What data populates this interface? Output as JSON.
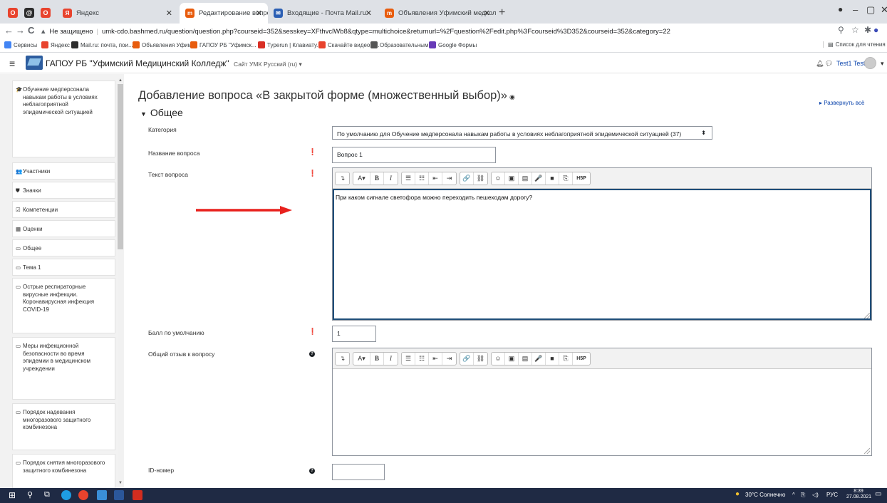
{
  "browser": {
    "pinned_tabs": [
      {
        "icon": "opera-icon",
        "color": "#e8432d",
        "letter": "O"
      },
      {
        "icon": "mailru-icon",
        "color": "#2d2d2d",
        "letter": "@"
      },
      {
        "icon": "opera-icon",
        "color": "#e8432d",
        "letter": "O"
      }
    ],
    "tabs": [
      {
        "label": "Яндекс",
        "active": false,
        "icon_color": "#e8432d"
      },
      {
        "label": "Редактирование вопроса «В за»",
        "active": true,
        "icon_color": "#e85c0d"
      },
      {
        "label": "Входящие - Почта Mail.ru",
        "active": false,
        "icon_color": "#2b5fb4"
      },
      {
        "label": "Объявления Уфимский медкол",
        "active": false,
        "icon_color": "#e85c0d"
      }
    ],
    "new_tab": "+",
    "security_label": "Не защищено",
    "url": "umk-cdo.bashmed.ru/question/question.php?courseid=352&sesskey=XFthvclWb8&qtype=multichoice&returnurl=%2Fquestion%2Fedit.php%3Fcourseid%3D352&courseid=352&category=22",
    "bookmarks": [
      {
        "label": "Сервисы",
        "color": "#4285f4"
      },
      {
        "label": "Яндекс",
        "color": "#e8432d"
      },
      {
        "label": "Mail.ru: почта, пои...",
        "color": "#2d2d2d"
      },
      {
        "label": "Объявления Уфим...",
        "color": "#e85c0d"
      },
      {
        "label": "ГАПОУ РБ \"Уфимск...",
        "color": "#e85c0d"
      },
      {
        "label": "Typerun | Клавиату...",
        "color": "#d93025"
      },
      {
        "label": "Скачайте видео и...",
        "color": "#e8432d"
      },
      {
        "label": "Образовательным...",
        "color": "#555555"
      },
      {
        "label": "Google Формы",
        "color": "#673ab7"
      }
    ],
    "reading_list": "Список для чтения"
  },
  "navbar": {
    "site_name": "ГАПОУ РБ \"Уфимский Медицинский Колледж\"",
    "site_link": "Сайт УМК",
    "language": "Русский (ru) ▾",
    "user": "Test1 Test"
  },
  "drawer": {
    "items": [
      {
        "icon": "graduation-cap-icon",
        "glyph": "🎓",
        "label": "Обучение медперсонала навыкам работы в условиях неблагоприятной эпидемической ситуацией"
      },
      {
        "icon": "users-icon",
        "glyph": "👥",
        "label": "Участники"
      },
      {
        "icon": "shield-icon",
        "glyph": "⛊",
        "label": "Значки"
      },
      {
        "icon": "check-square-icon",
        "glyph": "☑",
        "label": "Компетенции"
      },
      {
        "icon": "table-icon",
        "glyph": "▦",
        "label": "Оценки"
      },
      {
        "icon": "folder-icon",
        "glyph": "▭",
        "label": "Общее"
      },
      {
        "icon": "folder-icon",
        "glyph": "▭",
        "label": "Тема 1"
      },
      {
        "icon": "folder-icon",
        "glyph": "▭",
        "label": "Острые респираторные вирусные инфекции. Коронавирусная инфекция COVID-19"
      },
      {
        "icon": "folder-icon",
        "glyph": "▭",
        "label": "Меры инфекционной безопасности во время эпидемии в медицинском учреждении"
      },
      {
        "icon": "folder-icon",
        "glyph": "▭",
        "label": "Порядок надевания многоразового защитного комбинезона"
      },
      {
        "icon": "folder-icon",
        "glyph": "▭",
        "label": "Порядок снятия многоразового защитного комбинезона"
      }
    ]
  },
  "main": {
    "title": "Добавление вопроса «В закрытой форме (множественный выбор)»",
    "expand_all": "▸ Развернуть всё",
    "section": "Общее",
    "fields": {
      "category_label": "Категория",
      "category_value": "По умолчанию для Обучение медперсонала навыкам работы в условиях неблагоприятной эпидемической ситуацией (37)",
      "name_label": "Название вопроса",
      "name_value": "Вопрос 1",
      "text_label": "Текст вопроса",
      "text_value": "При каком сигнале светофора можно переходить пешеходам дорогу?",
      "grade_label": "Балл по умолчанию",
      "grade_value": "1",
      "feedback_label": "Общий отзыв к вопросу",
      "feedback_value": "",
      "idnumber_label": "ID-номер",
      "idnumber_value": ""
    },
    "toolbar_buttons": [
      "↴",
      "A▾",
      "B",
      "I",
      "☰",
      "☷",
      "⇤",
      "⇥",
      "🔗",
      "⛓",
      "☺",
      "▣",
      "▤",
      "🎤",
      "■",
      "⎘",
      "H5P"
    ]
  },
  "annotation": {
    "arrow_color": "#e8211d"
  },
  "taskbar": {
    "weather": "30°C Солнечно",
    "lang": "РУС",
    "time": "8:39",
    "date": "27.08.2021"
  }
}
